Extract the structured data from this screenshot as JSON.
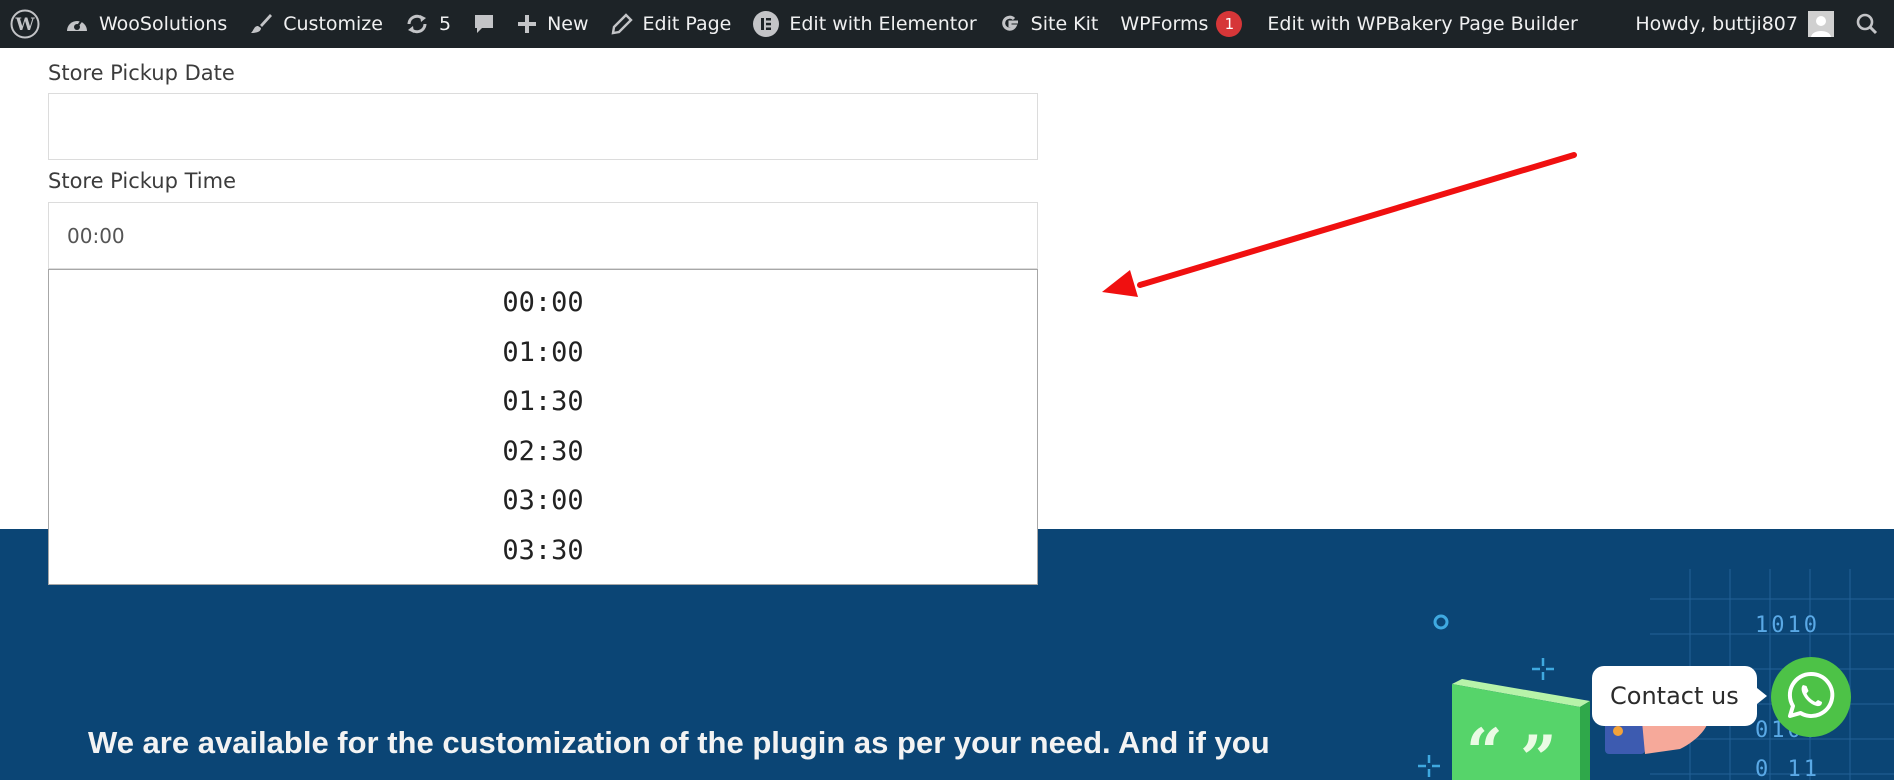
{
  "adminbar": {
    "site_name": "WooSolutions",
    "customize": "Customize",
    "updates_count": "5",
    "new": "New",
    "edit_page": "Edit Page",
    "edit_elementor": "Edit with Elementor",
    "site_kit": "Site Kit",
    "wpforms": "WPForms",
    "wpforms_badge": "1",
    "edit_wpbakery": "Edit with WPBakery Page Builder",
    "howdy": "Howdy, buttji807"
  },
  "form": {
    "date_label": "Store Pickup Date",
    "date_value": "",
    "time_label": "Store Pickup Time",
    "time_value": "00:00",
    "time_options": [
      "00:00",
      "01:00",
      "01:30",
      "02:30",
      "03:00",
      "03:30"
    ]
  },
  "promo": {
    "text": "We are available for the customization of the plugin as per your need. And if you"
  },
  "illustration": {
    "binary_rows": [
      "1010",
      "0100",
      "0 11"
    ]
  },
  "contact": {
    "label": "Contact us"
  },
  "colors": {
    "adminbar_bg": "#1d2327",
    "section_bg": "#0b4575",
    "whatsapp": "#4dc247",
    "annotation_arrow": "#f01010",
    "badge": "#d63638"
  }
}
